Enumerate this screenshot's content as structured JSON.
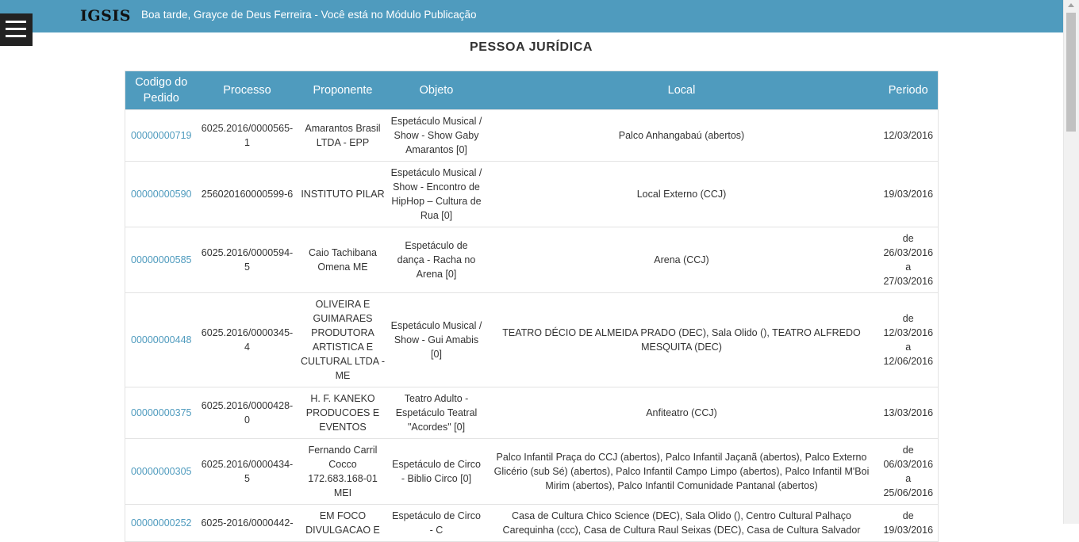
{
  "header": {
    "brand": "IGSIS",
    "greeting": "Boa tarde, Grayce de Deus Ferreira - Você está no Módulo Publicação"
  },
  "page": {
    "title": "PESSOA JURÍDICA"
  },
  "table": {
    "columns": [
      "Codigo do Pedido",
      "Processo",
      "Proponente",
      "Objeto",
      "Local",
      "Periodo"
    ],
    "rows": [
      {
        "codigo": "00000000719",
        "processo": "6025.2016/0000565-1",
        "proponente": "Amarantos Brasil LTDA - EPP",
        "objeto": "Espetáculo Musical / Show - Show Gaby Amarantos [0]",
        "local": "Palco Anhangabaú (abertos)",
        "periodo": "12/03/2016"
      },
      {
        "codigo": "00000000590",
        "processo": "256020160000599-6",
        "proponente": "INSTITUTO PILAR",
        "objeto": "Espetáculo Musical / Show - Encontro de HipHop – Cultura de Rua [0]",
        "local": "Local Externo (CCJ)",
        "periodo": "19/03/2016"
      },
      {
        "codigo": "00000000585",
        "processo": "6025.2016/0000594-5",
        "proponente": "Caio Tachibana Omena ME",
        "objeto": "Espetáculo de dança - Racha no Arena [0]",
        "local": "Arena (CCJ)",
        "periodo": "de 26/03/2016 a 27/03/2016"
      },
      {
        "codigo": "00000000448",
        "processo": "6025.2016/0000345-4",
        "proponente": "OLIVEIRA E GUIMARAES PRODUTORA ARTISTICA E CULTURAL LTDA - ME",
        "objeto": "Espetáculo Musical / Show - Gui Amabis [0]",
        "local": "TEATRO DÉCIO DE ALMEIDA PRADO (DEC), Sala Olido (), TEATRO ALFREDO MESQUITA (DEC)",
        "periodo": "de 12/03/2016 a 12/06/2016"
      },
      {
        "codigo": "00000000375",
        "processo": "6025.2016/0000428-0",
        "proponente": "H. F. KANEKO PRODUCOES E EVENTOS",
        "objeto": "Teatro Adulto - Espetáculo Teatral \"Acordes\" [0]",
        "local": "Anfiteatro (CCJ)",
        "periodo": "13/03/2016"
      },
      {
        "codigo": "00000000305",
        "processo": "6025.2016/0000434-5",
        "proponente": "Fernando Carril Cocco 172.683.168-01 MEI",
        "objeto": "Espetáculo de Circo - Biblio Circo [0]",
        "local": "Palco Infantil Praça do CCJ (abertos), Palco Infantil Jaçanã (abertos), Palco Externo Glicério (sub Sé) (abertos), Palco Infantil Campo Limpo (abertos), Palco Infantil M'Boi Mirim (abertos), Palco Infantil Comunidade Pantanal (abertos)",
        "periodo": "de 06/03/2016 a 25/06/2016"
      },
      {
        "codigo": "00000000252",
        "processo": "6025-2016/0000442-",
        "proponente": "EM FOCO DIVULGACAO E",
        "objeto": "Espetáculo de Circo - C",
        "local": "Casa de Cultura Chico Science (DEC), Sala Olido (), Centro Cultural Palhaço Carequinha (ccc), Casa de Cultura Raul Seixas (DEC), Casa de Cultura Salvador",
        "periodo": "de 19/03/2016"
      }
    ]
  },
  "colors": {
    "accent": "#4f9bbe",
    "menu_button": "#222222"
  },
  "icons": {
    "menu": "hamburger-menu-icon"
  }
}
